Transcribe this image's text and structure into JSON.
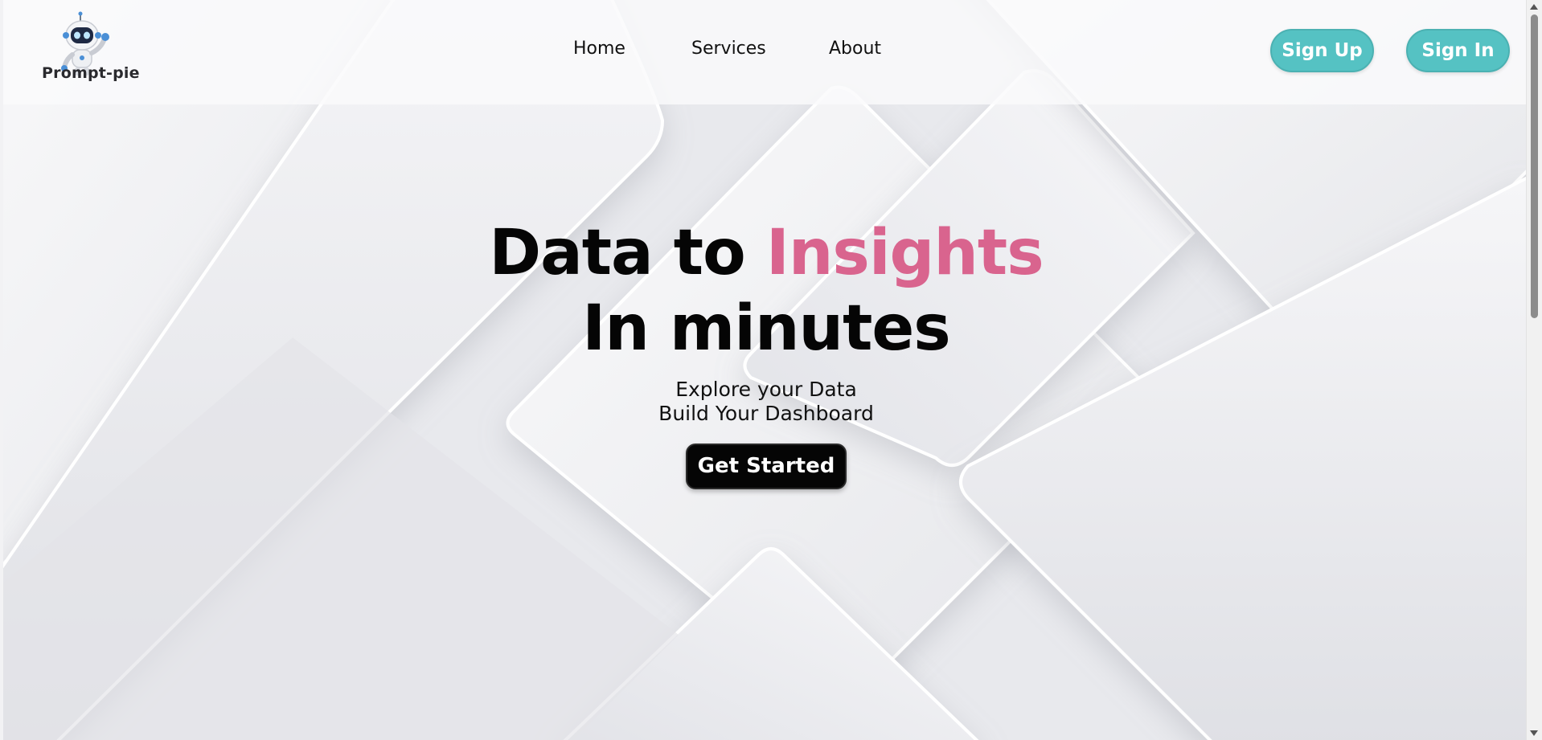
{
  "brand": {
    "name": "Prompt-pie",
    "logo_icon": "robot-mascot-icon"
  },
  "nav": {
    "items": [
      {
        "label": "Home"
      },
      {
        "label": "Services"
      },
      {
        "label": "About"
      }
    ]
  },
  "auth": {
    "signup_label": "Sign Up",
    "signin_label": "Sign In"
  },
  "hero": {
    "title_part1": "Data to ",
    "title_accent": "Insights",
    "title_line2": "In minutes",
    "subtitle_line1": "Explore your Data",
    "subtitle_line2": "Build Your Dashboard",
    "cta_label": "Get Started"
  },
  "colors": {
    "accent_pink": "#d9648e",
    "button_teal": "#55c2c3",
    "cta_black": "#050505"
  }
}
